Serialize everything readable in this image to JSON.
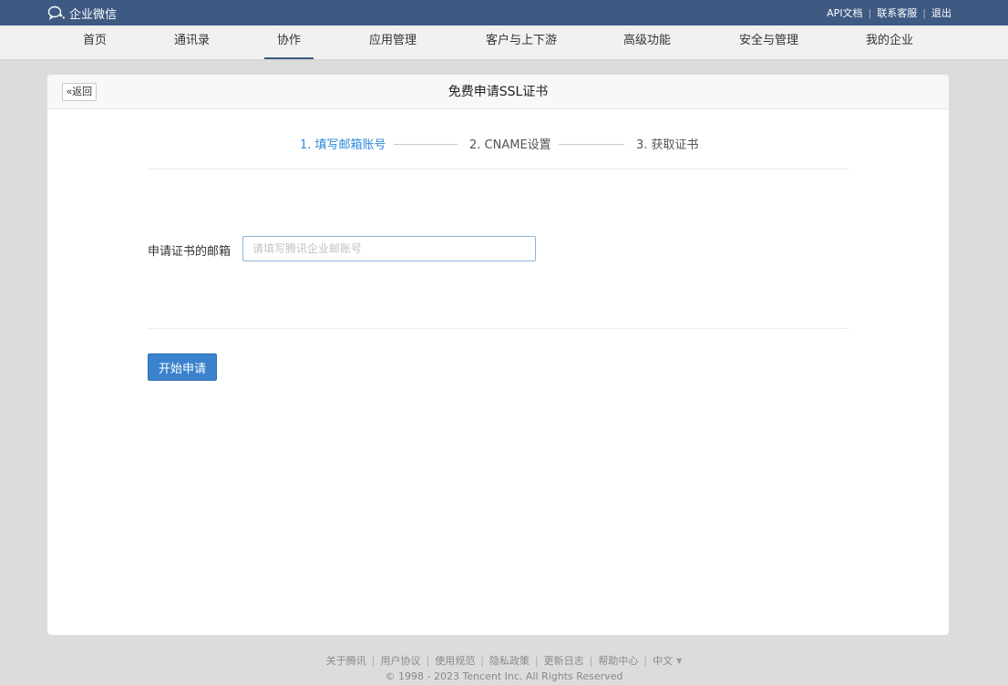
{
  "topbar": {
    "brand": "企业微信",
    "links": [
      {
        "label": "API文档"
      },
      {
        "label": "联系客服"
      },
      {
        "label": "退出"
      }
    ],
    "colors": {
      "background": "#3e5a82"
    }
  },
  "nav": {
    "items": [
      {
        "label": "首页"
      },
      {
        "label": "通讯录"
      },
      {
        "label": "协作",
        "active": true
      },
      {
        "label": "应用管理"
      },
      {
        "label": "客户与上下游"
      },
      {
        "label": "高级功能"
      },
      {
        "label": "安全与管理"
      },
      {
        "label": "我的企业"
      }
    ]
  },
  "card": {
    "back_label": "«返回",
    "title": "免费申请SSL证书",
    "steps": [
      {
        "label": "1. 填写邮箱账号",
        "active": true
      },
      {
        "label": "2. CNAME设置",
        "active": false
      },
      {
        "label": "3. 获取证书",
        "active": false
      }
    ],
    "form": {
      "email_label": "申请证书的邮箱",
      "email_value": "",
      "email_placeholder": "请填写腾讯企业邮账号"
    },
    "submit_label": "开始申请"
  },
  "footer": {
    "links": [
      {
        "label": "关于腾讯"
      },
      {
        "label": "用户协议"
      },
      {
        "label": "使用规范"
      },
      {
        "label": "隐私政策"
      },
      {
        "label": "更新日志"
      },
      {
        "label": "帮助中心"
      }
    ],
    "language": "中文",
    "copyright": "© 1998 - 2023 Tencent Inc. All Rights Reserved"
  },
  "colors": {
    "accent": "#2d88d9",
    "primary_button": "#3a82cc",
    "page_background": "#dcdcdc"
  }
}
